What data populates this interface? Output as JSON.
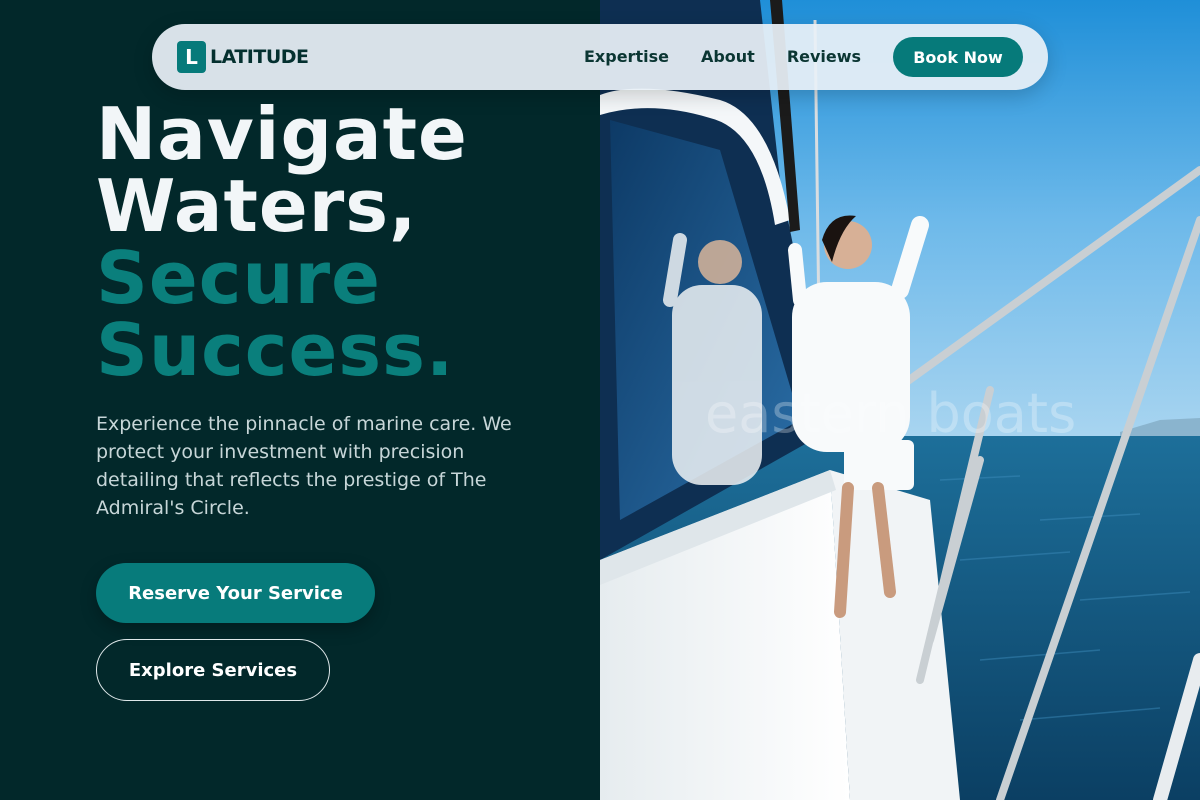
{
  "brand": {
    "logo_letter": "L",
    "name": "LATITUDE"
  },
  "nav": {
    "links": [
      "Expertise",
      "About",
      "Reviews"
    ],
    "cta": "Book Now"
  },
  "hero": {
    "headline_line1": "Navigate",
    "headline_line2": "Waters,",
    "headline_line3": "Secure",
    "headline_line4": "Success.",
    "description": "Experience the pinnacle of marine care. We protect your investment with precision detailing that reflects the prestige of The Admiral's Circle.",
    "primary_cta": "Reserve Your Service",
    "secondary_cta": "Explore Services"
  },
  "photo": {
    "watermark": "eastern boats"
  },
  "colors": {
    "background_dark": "#02282a",
    "accent_teal": "#077b7b",
    "headline_light": "#f2f6f8",
    "navbar_bg": "#e8f0f6"
  }
}
